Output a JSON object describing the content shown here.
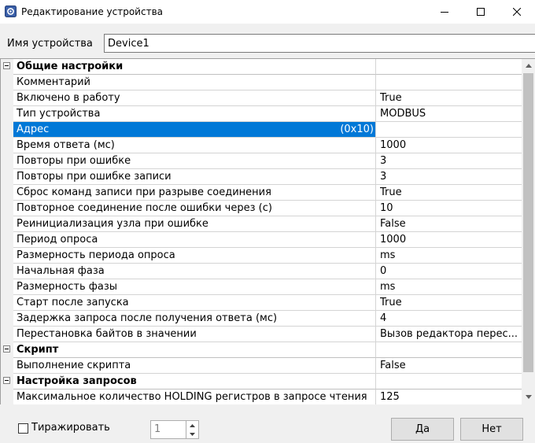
{
  "window": {
    "title": "Редактирование устройства",
    "minimize_icon": "minimize-icon",
    "maximize_icon": "maximize-icon",
    "close_icon": "close-icon"
  },
  "device": {
    "label": "Имя устройства",
    "value": "Device1"
  },
  "grid": {
    "rows": [
      {
        "type": "category",
        "name": "Общие настройки",
        "value": ""
      },
      {
        "type": "prop",
        "name": "Комментарий",
        "value": ""
      },
      {
        "type": "prop",
        "name": "Включено в работу",
        "value": "True"
      },
      {
        "type": "prop",
        "name": "Тип устройства",
        "value": "MODBUS"
      },
      {
        "type": "prop",
        "name": "Адрес",
        "value": "16",
        "hint": "(0x10)",
        "selected": true
      },
      {
        "type": "prop",
        "name": "Время ответа (мс)",
        "value": "1000"
      },
      {
        "type": "prop",
        "name": "Повторы при ошибке",
        "value": "3"
      },
      {
        "type": "prop",
        "name": "Повторы при ошибке записи",
        "value": "3"
      },
      {
        "type": "prop",
        "name": "Сброс команд записи при разрыве соединения",
        "value": "True"
      },
      {
        "type": "prop",
        "name": "Повторное соединение после ошибки через (с)",
        "value": "10"
      },
      {
        "type": "prop",
        "name": "Реинициализация узла при ошибке",
        "value": "False"
      },
      {
        "type": "prop",
        "name": "Период опроса",
        "value": "1000"
      },
      {
        "type": "prop",
        "name": "Размерность периода опроса",
        "value": "ms"
      },
      {
        "type": "prop",
        "name": "Начальная фаза",
        "value": "0"
      },
      {
        "type": "prop",
        "name": "Размерность фазы",
        "value": "ms"
      },
      {
        "type": "prop",
        "name": "Старт после запуска",
        "value": "True"
      },
      {
        "type": "prop",
        "name": "Задержка запроса после получения ответа (мс)",
        "value": "4"
      },
      {
        "type": "prop",
        "name": "Перестановка байтов в значении",
        "value": "Вызов редактора перес..."
      },
      {
        "type": "category",
        "name": "Скрипт",
        "value": ""
      },
      {
        "type": "prop",
        "name": "Выполнение скрипта",
        "value": "False"
      },
      {
        "type": "category",
        "name": "Настройка запросов",
        "value": ""
      },
      {
        "type": "prop",
        "name": "Максимальное количество HOLDING регистров в запросе чтения",
        "value": "125"
      }
    ]
  },
  "footer": {
    "replicate_label": "Тиражировать",
    "replicate_checked": false,
    "count_value": "1",
    "ok_label": "Да",
    "cancel_label": "Нет"
  }
}
